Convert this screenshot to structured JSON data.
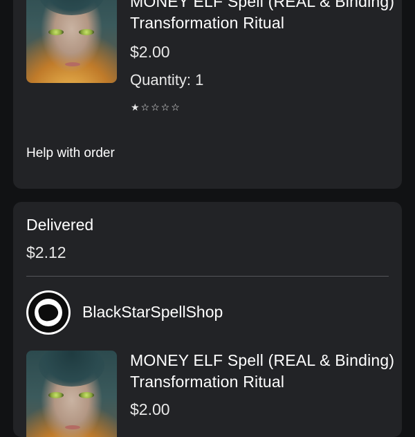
{
  "order_item": {
    "title": "MONEY ELF Spell (REAL & Binding) Transformation Ritual",
    "price": "$2.00",
    "quantity": "Quantity: 1",
    "rating_stars": "★☆☆☆☆",
    "help_link": "Help with order"
  },
  "order_card": {
    "status": "Delivered",
    "total": "$2.12",
    "shop_name": "BlackStarSpellShop",
    "item_title": "MONEY ELF Spell (REAL & Binding) Transformation Ritual",
    "item_price": "$2.00"
  },
  "colors": {
    "background": "#111214",
    "card": "#222326",
    "text": "#ffffff"
  }
}
